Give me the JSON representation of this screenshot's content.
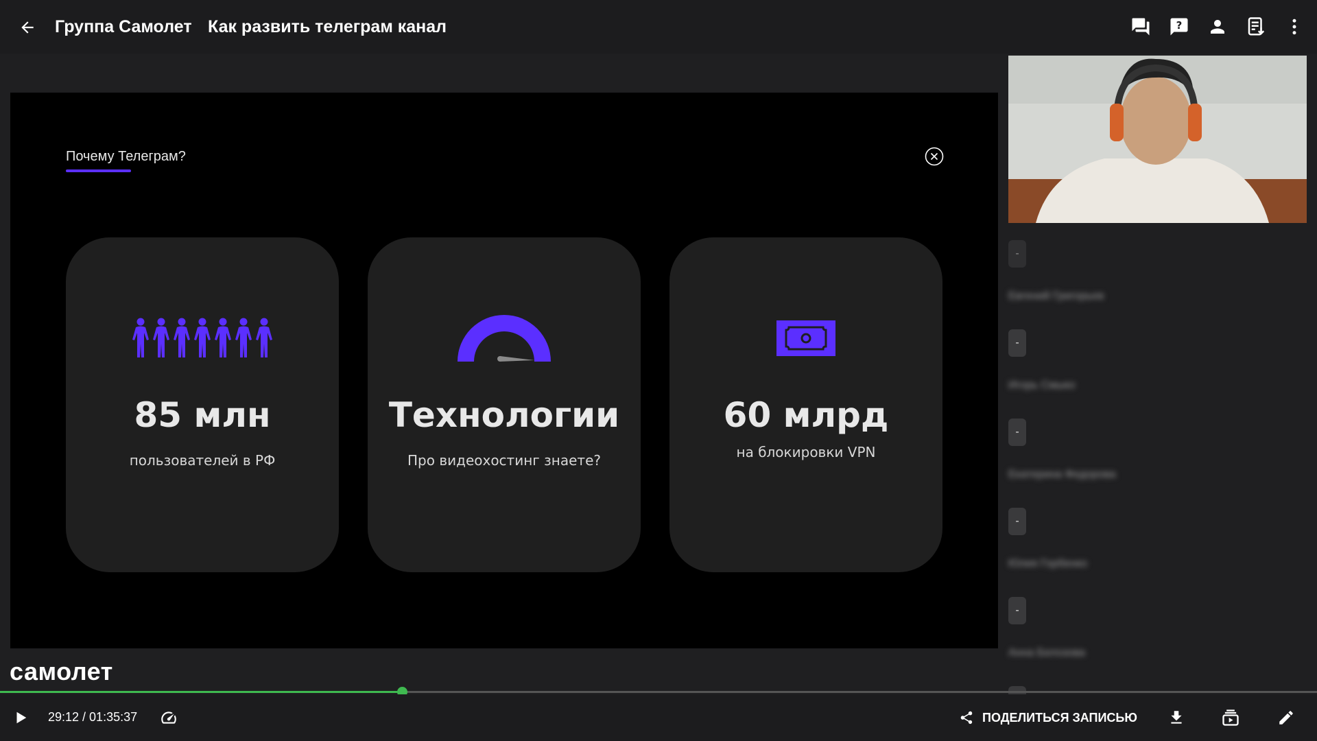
{
  "header": {
    "group_name": "Группа Самолет",
    "meeting_title": "Как развить телеграм канал",
    "icons": [
      "arrow-left-icon",
      "chat-icon",
      "question-icon",
      "person-icon",
      "transcript-download-icon",
      "more-vert-icon"
    ]
  },
  "slide": {
    "tab_label": "Почему Телеграм?",
    "accent_color": "#5b2fff",
    "cards": [
      {
        "icon": "people-icon",
        "value": "85 млн",
        "caption": "пользователей в РФ"
      },
      {
        "icon": "speedometer-icon",
        "value": "Технологии",
        "caption": "Про видеохостинг знаете?"
      },
      {
        "icon": "money-bill-icon",
        "value": "60 млрд",
        "caption": "на блокировки VPN"
      }
    ]
  },
  "participants": {
    "first_badge": "-",
    "items": [
      {
        "name": "Евгений Григорьев",
        "badge": "-"
      },
      {
        "name": "Игорь Смыко",
        "badge": "-"
      },
      {
        "name": "Екатерина Федорова",
        "badge": "-"
      },
      {
        "name": "Юлия Горбенко",
        "badge": "-"
      },
      {
        "name": "Анна Белозова",
        "badge": "-"
      }
    ]
  },
  "brand": "самолет",
  "player": {
    "current_time": "29:12",
    "total_time": "01:35:37",
    "time_display": "29:12 / 01:35:37",
    "progress_fraction": 0.305,
    "progress_color": "#3fb950",
    "share_label": "ПОДЕЛИТЬСЯ ЗАПИСЬЮ"
  }
}
